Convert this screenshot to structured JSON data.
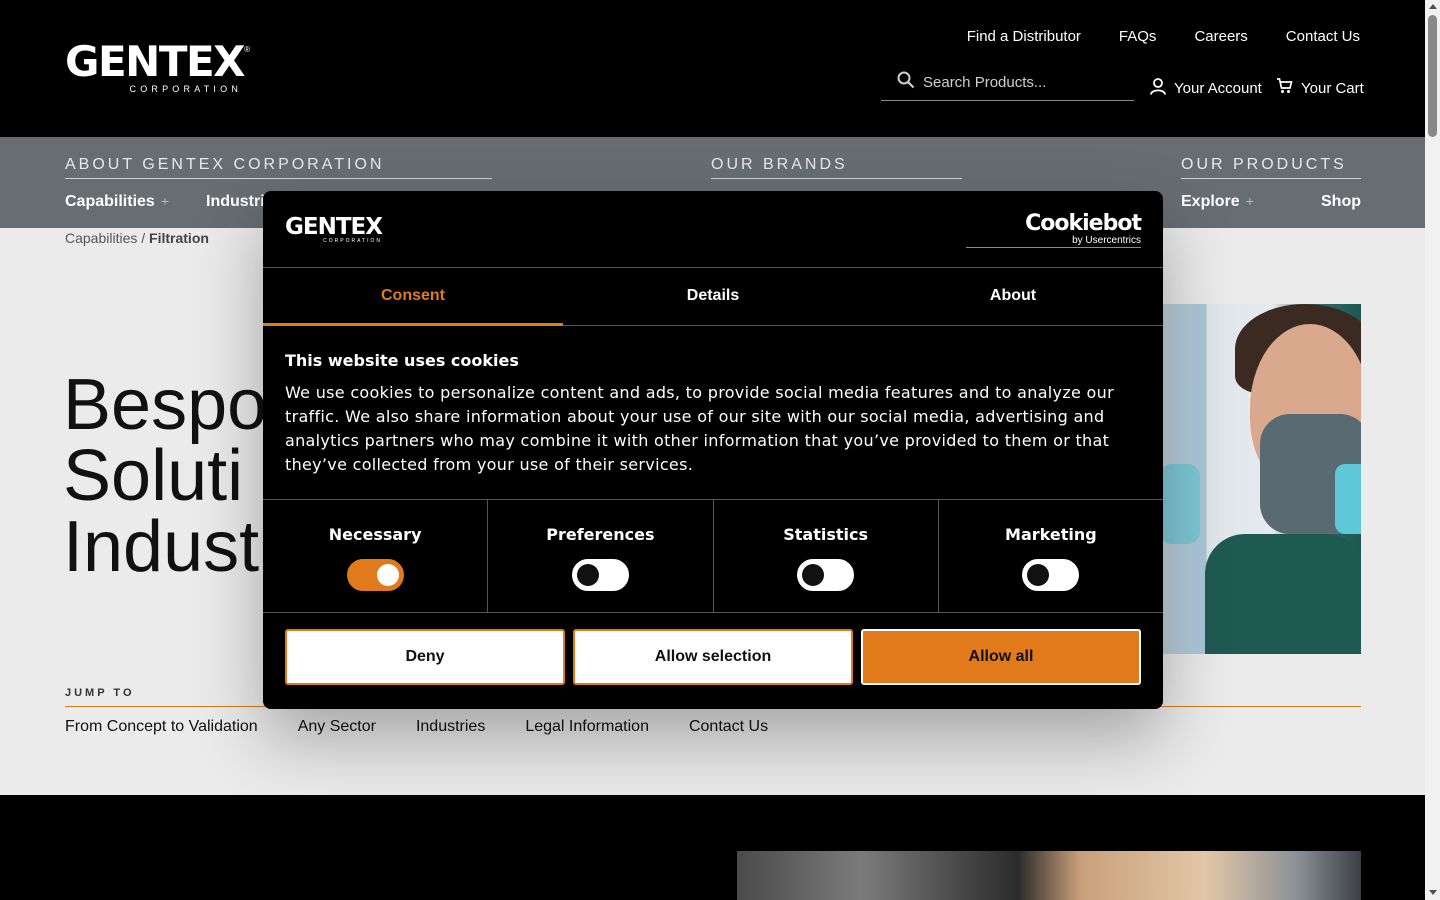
{
  "header": {
    "logo_word": "GENTEX",
    "logo_registered": "®",
    "logo_sub": "CORPORATION",
    "util_links": [
      "Find a Distributor",
      "FAQs",
      "Careers",
      "Contact Us"
    ],
    "search_placeholder": "Search Products...",
    "account_label": "Your Account",
    "cart_label": "Your Cart"
  },
  "nav": {
    "about_title": "ABOUT GENTEX CORPORATION",
    "brands_title": "OUR BRANDS",
    "products_title": "OUR PRODUCTS",
    "capabilities": "Capabilities",
    "industries": "Industri",
    "explore": "Explore",
    "shop": "Shop",
    "plus": "+"
  },
  "breadcrumb": {
    "parent": "Capabilities",
    "separator": " / ",
    "current": "Filtration"
  },
  "hero": {
    "line1": "Bespo",
    "line2": "Soluti",
    "line3": "Indust"
  },
  "jump": {
    "label": "JUMP TO",
    "links": [
      "From Concept to Validation",
      "Any Sector",
      "Industries",
      "Legal Information",
      "Contact Us"
    ]
  },
  "cookie": {
    "logo_word": "GENTEX",
    "logo_sub": "CORPORATION",
    "provider": "Cookiebot",
    "provider_sub": "by Usercentrics",
    "tabs": [
      "Consent",
      "Details",
      "About"
    ],
    "active_tab": "Consent",
    "title": "This website uses cookies",
    "body": "We use cookies to personalize content and ads, to provide social media features and to analyze our traffic. We also share information about your use of our site with our social media, advertising and analytics partners who may combine it with other information that you’ve provided to them or that they’ve collected from your use of their services.",
    "toggles": [
      {
        "label": "Necessary",
        "state": "on"
      },
      {
        "label": "Preferences",
        "state": "off"
      },
      {
        "label": "Statistics",
        "state": "off"
      },
      {
        "label": "Marketing",
        "state": "off"
      }
    ],
    "buttons": {
      "deny": "Deny",
      "allow_selection": "Allow selection",
      "allow_all": "Allow all"
    }
  },
  "colors": {
    "accent": "#e07a1a",
    "header_bg": "#000000",
    "nav_bg": "#686d72",
    "page_bg": "#ebebeb"
  }
}
